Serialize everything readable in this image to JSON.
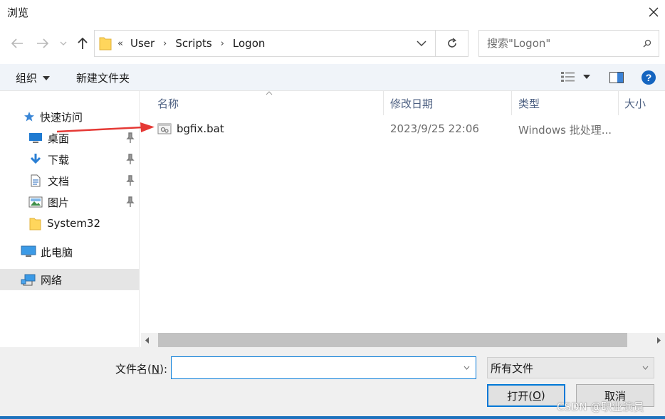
{
  "window": {
    "title": "浏览"
  },
  "address": {
    "crumbs": [
      "User",
      "Scripts",
      "Logon"
    ]
  },
  "search": {
    "placeholder": "搜索\"Logon\""
  },
  "toolbar": {
    "organize_label": "组织",
    "new_folder_label": "新建文件夹"
  },
  "sidebar": {
    "items": [
      {
        "label": "快速访问",
        "icon": "star-icon"
      },
      {
        "label": "桌面",
        "icon": "desktop-icon",
        "pinned": true
      },
      {
        "label": "下载",
        "icon": "download-icon",
        "pinned": true
      },
      {
        "label": "文档",
        "icon": "document-icon",
        "pinned": true
      },
      {
        "label": "图片",
        "icon": "picture-icon",
        "pinned": true
      },
      {
        "label": "System32",
        "icon": "folder-icon"
      },
      {
        "label": "此电脑",
        "icon": "computer-icon"
      },
      {
        "label": "网络",
        "icon": "network-icon",
        "selected": true
      }
    ]
  },
  "columns": {
    "name": "名称",
    "modified": "修改日期",
    "type": "类型",
    "size": "大小"
  },
  "files": [
    {
      "name": "bgfix.bat",
      "modified": "2023/9/25 22:06",
      "type": "Windows 批处理..."
    }
  ],
  "bottom": {
    "filename_label": "文件名(",
    "filename_accel": "N",
    "filename_label_end": "):",
    "filename_value": "",
    "filetype_value": "所有文件",
    "open_label": "打开(",
    "open_accel": "O",
    "open_label_end": ")",
    "cancel_label": "取消"
  },
  "watermark": "CSDN @职业演员",
  "colors": {
    "accent": "#0078d7",
    "selected_bg": "#e5e5e5",
    "arrow": "#e53935",
    "help": "#1565c0"
  }
}
